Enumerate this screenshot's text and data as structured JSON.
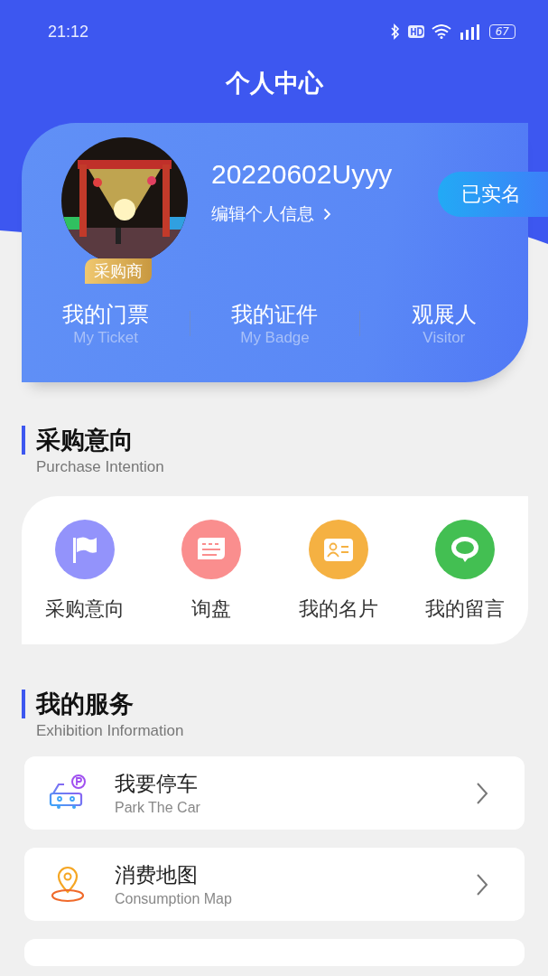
{
  "status_bar": {
    "time": "21:12",
    "battery": "67"
  },
  "title": "个人中心",
  "profile": {
    "role_badge": "采购商",
    "username": "20220602Uyyy",
    "edit_link": "编辑个人信息",
    "verified_badge": "已实名",
    "links": [
      {
        "label": "我的门票",
        "sublabel": "My Ticket"
      },
      {
        "label": "我的证件",
        "sublabel": "My Badge"
      },
      {
        "label": "观展人",
        "sublabel": "Visitor"
      }
    ]
  },
  "purchase_section": {
    "title": "采购意向",
    "subtitle": "Purchase Intention",
    "items": [
      {
        "label": "采购意向",
        "kind": "flag",
        "color": "#9393fb"
      },
      {
        "label": "询盘",
        "kind": "message",
        "color": "#fa8e8e"
      },
      {
        "label": "我的名片",
        "kind": "card",
        "color": "#f5b142"
      },
      {
        "label": "我的留言",
        "kind": "chat",
        "color": "#43bf52"
      }
    ]
  },
  "service_section": {
    "title": "我的服务",
    "subtitle": "Exhibition Information",
    "items": [
      {
        "title": "我要停车",
        "subtitle": "Park The Car",
        "kind": "parking"
      },
      {
        "title": "消费地图",
        "subtitle": "Consumption Map",
        "kind": "map"
      },
      {
        "kind": "partial"
      }
    ]
  }
}
